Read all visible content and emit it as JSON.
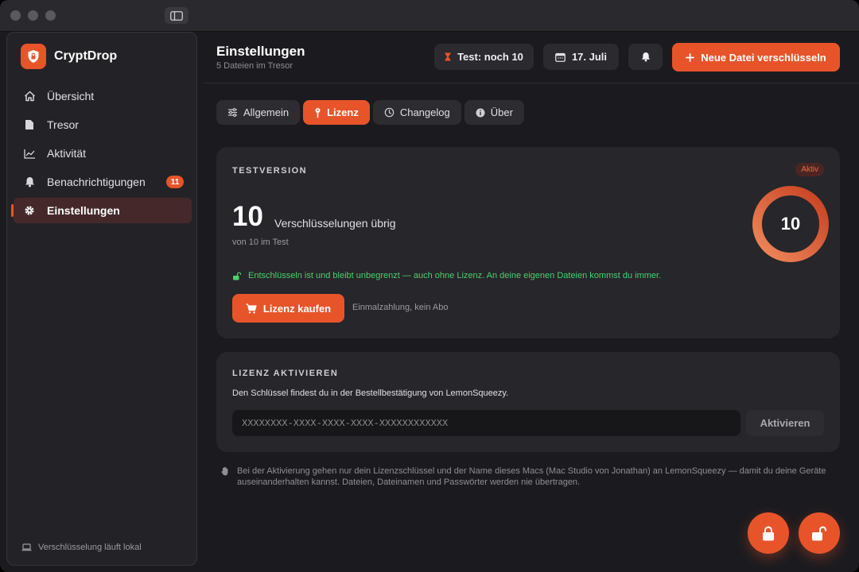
{
  "app": {
    "name": "CryptDrop"
  },
  "sidebar": {
    "items": [
      {
        "label": "Übersicht",
        "icon": "home-icon"
      },
      {
        "label": "Tresor",
        "icon": "file-icon"
      },
      {
        "label": "Aktivität",
        "icon": "chart-icon"
      },
      {
        "label": "Benachrichtigungen",
        "icon": "bell-icon",
        "badge": "11"
      },
      {
        "label": "Einstellungen",
        "icon": "gear-icon",
        "active": true
      }
    ],
    "footer": "Verschlüsselung läuft lokal"
  },
  "header": {
    "title": "Einstellungen",
    "subtitle": "5 Dateien im Tresor",
    "trial_pill": "Test: noch 10",
    "date_pill": "17. Juli",
    "new_button": "Neue Datei verschlüsseln"
  },
  "tabs": [
    {
      "label": "Allgemein",
      "icon": "sliders-icon"
    },
    {
      "label": "Lizenz",
      "icon": "key-icon",
      "active": true
    },
    {
      "label": "Changelog",
      "icon": "history-icon"
    },
    {
      "label": "Über",
      "icon": "info-icon"
    }
  ],
  "trial_card": {
    "label": "TESTVERSION",
    "status": "Aktiv",
    "remaining": "10",
    "remaining_text": "Verschlüsselungen übrig",
    "of_text": "von 10 im Test",
    "ring_value": "10",
    "ring_fraction": 1.0,
    "note": "Entschlüsseln ist und bleibt unbegrenzt — auch ohne Lizenz. An deine eigenen Dateien kommst du immer.",
    "buy_button": "Lizenz kaufen",
    "buy_note": "Einmalzahlung, kein Abo"
  },
  "activate_card": {
    "label": "LIZENZ AKTIVIEREN",
    "description": "Den Schlüssel findest du in der Bestellbestätigung von LemonSqueezy.",
    "placeholder": "XXXXXXXX-XXXX-XXXX-XXXX-XXXXXXXXXXXX",
    "button": "Aktivieren"
  },
  "privacy_note": "Bei der Aktivierung gehen nur dein Lizenzschlüssel und der Name dieses Macs (Mac Studio von Jonathan) an LemonSqueezy — damit du deine Geräte auseinanderhalten kannst. Dateien, Dateinamen und Passwörter werden nie übertragen.",
  "colors": {
    "accent": "#e8542a",
    "success": "#4cd16a",
    "background": "#1b1b1f",
    "card": "#26262b"
  }
}
